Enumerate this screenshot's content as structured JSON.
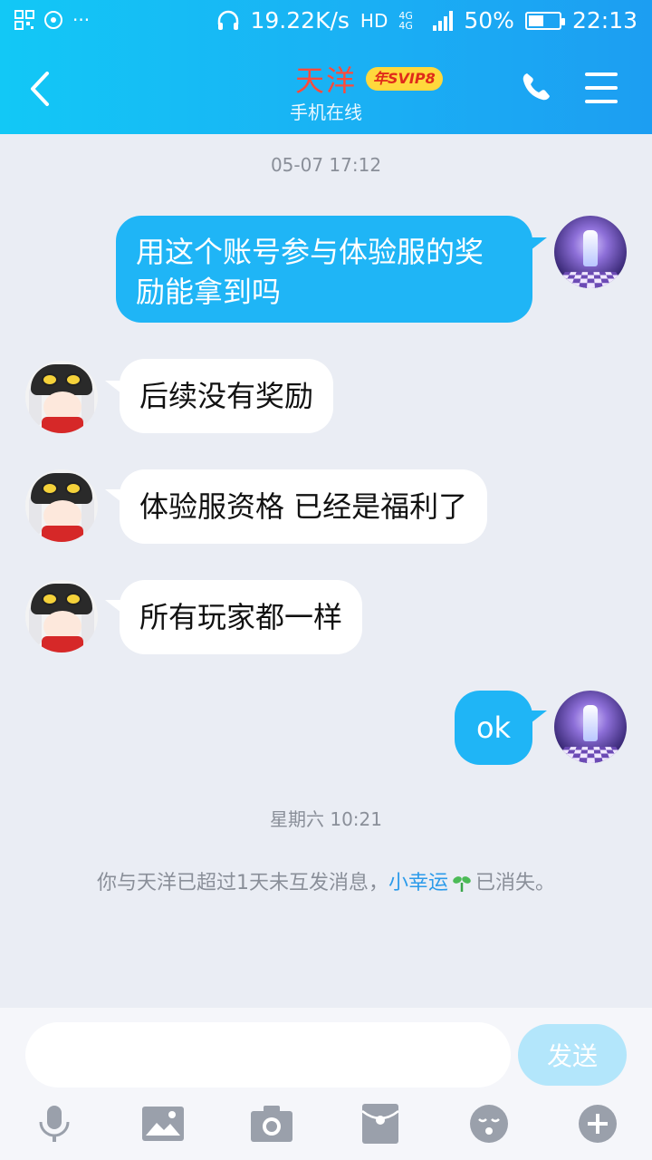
{
  "status_bar": {
    "speed": "19.22K/s",
    "hd": "HD",
    "net_type": "4G 4G",
    "battery": "50%",
    "battery_level": 0.5,
    "time": "22:13",
    "left_icons": [
      "qr-scan-icon",
      "steam-icon",
      "more-dots-icon"
    ],
    "dots": "···"
  },
  "header": {
    "contact_name": "天洋",
    "badge": "年SVIP8",
    "status": "手机在线"
  },
  "messages": [
    {
      "type": "time",
      "text": "05-07 17:12"
    },
    {
      "type": "out",
      "text_line1": "用这个账号参与体验服的奖",
      "text_line2": "励能拿到吗"
    },
    {
      "type": "in",
      "text": "后续没有奖励"
    },
    {
      "type": "in",
      "text": "体验服资格 已经是福利了"
    },
    {
      "type": "in",
      "text": "所有玩家都一样"
    },
    {
      "type": "out",
      "text": "ok"
    },
    {
      "type": "time",
      "text": "星期六 10:21"
    }
  ],
  "system_message": {
    "prefix": "你与天洋已超过1天未互发消息，",
    "link": "小幸运",
    "suffix": "已消失。"
  },
  "input": {
    "placeholder": "",
    "send_label": "发送"
  },
  "toolbar": [
    "microphone-icon",
    "image-icon",
    "camera-icon",
    "red-packet-icon",
    "emoji-icon",
    "plus-icon"
  ],
  "colors": {
    "accent": "#1fb5f6",
    "name": "#ff4b3b",
    "badge_bg": "#ffd83c",
    "link": "#2c9bea"
  }
}
